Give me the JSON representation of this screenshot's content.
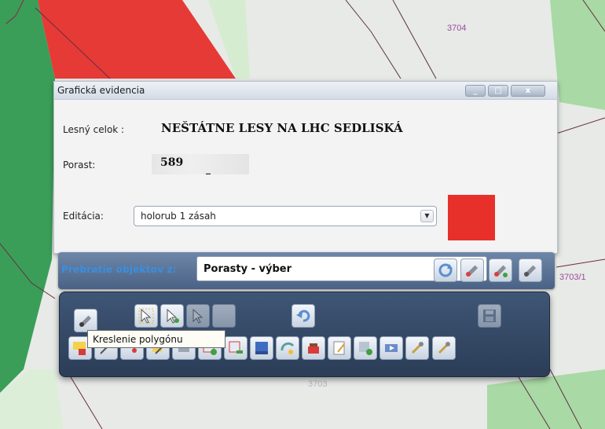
{
  "window": {
    "title": "Grafická evidencia"
  },
  "map_labels": [
    "3704",
    "3703/1",
    "3703"
  ],
  "lesny_celok": {
    "label": "Lesný celok :",
    "value": "NEŠTÁTNE LESY NA LHC SEDLISKÁ"
  },
  "porast": {
    "label": "Porast:",
    "value": "589",
    "suffix": "_"
  },
  "editacia": {
    "label": "Editácia:",
    "selected": "holorub 1 zásah",
    "color": "#e8302a"
  },
  "prebratie": {
    "label": "Prebratie objektov z:",
    "selected": "Porasty - výber"
  },
  "tooltip": "Kreslenie polygónu",
  "toolbar_icons": {
    "row1": [
      "draw-polygon-icon",
      "select-arrow-icon",
      "select-add-icon",
      "select-remove-icon",
      "blank-icon",
      "undo-icon",
      "save-disk-icon"
    ],
    "row2": [
      "new-layer-icon",
      "line-tool-icon",
      "point-tool-icon",
      "edit-icon",
      "layer-tool-icon",
      "add-vertex-icon",
      "remove-vertex-icon",
      "table-icon",
      "rotate-icon",
      "red-basket-icon",
      "notes-icon",
      "new-feature-icon",
      "import-icon",
      "tools-icon"
    ]
  }
}
